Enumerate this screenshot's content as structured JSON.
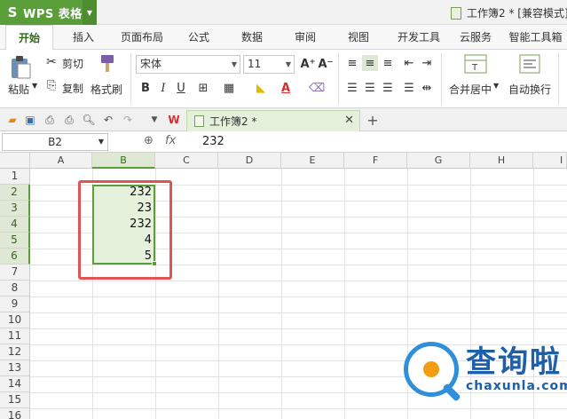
{
  "app": {
    "name": "WPS 表格",
    "document_title": "工作簿2 * [兼容模式]"
  },
  "tabs": [
    "开始",
    "插入",
    "页面布局",
    "公式",
    "数据",
    "审阅",
    "视图",
    "开发工具",
    "云服务",
    "智能工具箱"
  ],
  "active_tab": "开始",
  "ribbon": {
    "paste": "粘贴",
    "cut": "剪切",
    "copy": "复制",
    "format_painter": "格式刷",
    "font_name": "宋体",
    "font_size": "11",
    "merge_center": "合并居中",
    "wrap_text": "自动换行"
  },
  "doc_tab": {
    "title": "工作簿2 *"
  },
  "formula_bar": {
    "name_box": "B2",
    "fx": "fx",
    "value": "232"
  },
  "sheet": {
    "columns": [
      "A",
      "B",
      "C",
      "D",
      "E",
      "F",
      "G",
      "H",
      "I"
    ],
    "rows": [
      "1",
      "2",
      "3",
      "4",
      "5",
      "6",
      "7",
      "8",
      "9",
      "10",
      "11",
      "12",
      "13",
      "14",
      "15",
      "16"
    ],
    "selected_column": "B",
    "selected_rows": [
      "2",
      "3",
      "4",
      "5",
      "6"
    ],
    "cells_B": [
      "232",
      "23",
      "232",
      "4",
      "5"
    ]
  },
  "watermark": {
    "cn": "查询啦",
    "en": "chaxunla.com"
  },
  "colors": {
    "accent": "#5a9e3a",
    "highlight_box": "#e05454",
    "watermark": "#1d5fa8"
  }
}
